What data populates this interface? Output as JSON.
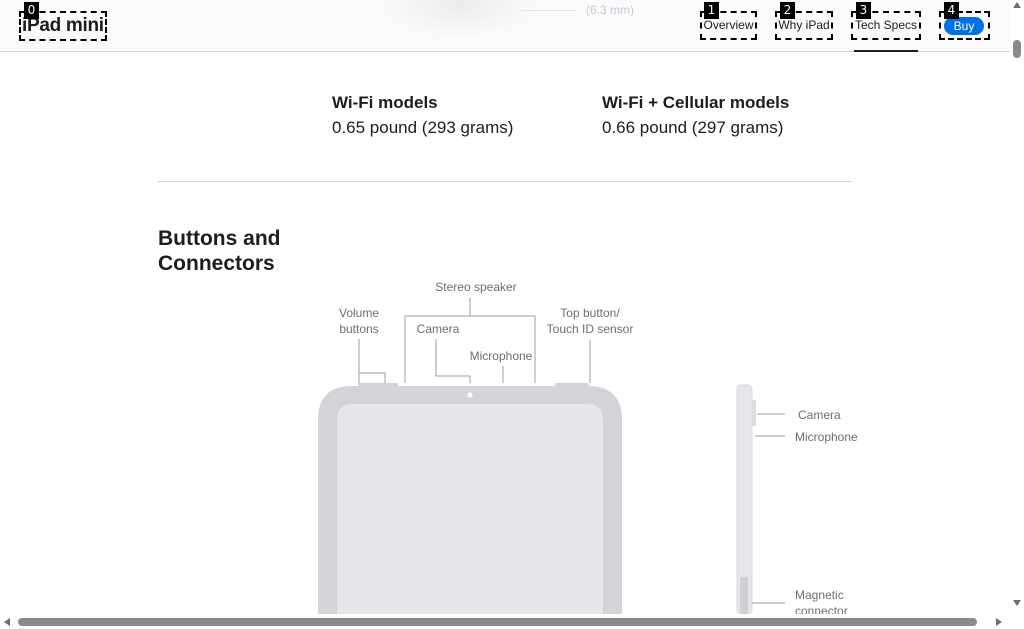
{
  "nav": {
    "product_name": "iPad mini",
    "ghost_text": "(6.3 mm)",
    "links": {
      "overview": "Overview",
      "why_ipad": "Why iPad",
      "tech_specs": "Tech Specs"
    },
    "buy_label": "Buy",
    "active_tab": "Tech Specs",
    "accent_color": "#0071e3"
  },
  "badges": [
    "0",
    "1",
    "2",
    "3",
    "4"
  ],
  "weight": {
    "wifi": {
      "title": "Wi-Fi models",
      "value": "0.65 pound (293 grams)"
    },
    "cellular": {
      "title": "Wi-Fi + Cellular models",
      "value": "0.66 pound (297 grams)"
    }
  },
  "buttons_connectors": {
    "title": "Buttons and Connectors",
    "front_labels": {
      "volume_line1": "Volume",
      "volume_line2": "buttons",
      "stereo_speaker": "Stereo speaker",
      "camera": "Camera",
      "microphone": "Microphone",
      "top_button_line1": "Top button/",
      "top_button_line2": "Touch ID sensor"
    },
    "side_labels": {
      "camera": "Camera",
      "microphone": "Microphone",
      "magnetic_line1": "Magnetic",
      "magnetic_line2": "connector"
    }
  },
  "scrollbars": {
    "vertical": "scrollbar",
    "horizontal": "scrollbar"
  }
}
